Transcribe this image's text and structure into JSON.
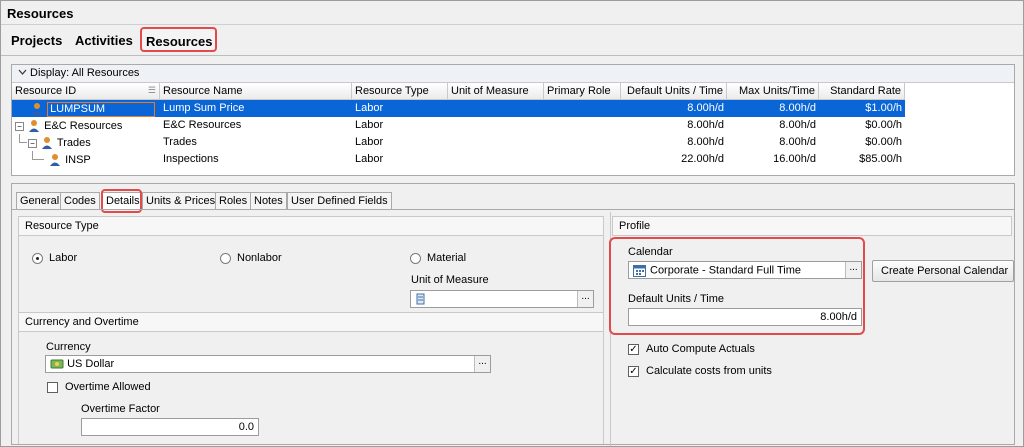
{
  "window": {
    "title": "Resources"
  },
  "nav": {
    "tabs": [
      {
        "label": "Projects"
      },
      {
        "label": "Activities"
      },
      {
        "label": "Resources"
      }
    ]
  },
  "grid": {
    "display_label": "Display: All Resources",
    "columns": [
      "Resource ID",
      "Resource Name",
      "Resource Type",
      "Unit of Measure",
      "Primary Role",
      "Default Units / Time",
      "Max Units/Time",
      "Standard Rate"
    ],
    "rows": [
      {
        "id": "LUMPSUM",
        "name": "Lump Sum Price",
        "type": "Labor",
        "unit": "",
        "role": "",
        "default_units": "8.00h/d",
        "max_units": "8.00h/d",
        "rate": "$1.00/h"
      },
      {
        "id": "E&C Resources",
        "name": "E&C Resources",
        "type": "Labor",
        "unit": "",
        "role": "",
        "default_units": "8.00h/d",
        "max_units": "8.00h/d",
        "rate": "$0.00/h"
      },
      {
        "id": "Trades",
        "name": "Trades",
        "type": "Labor",
        "unit": "",
        "role": "",
        "default_units": "8.00h/d",
        "max_units": "8.00h/d",
        "rate": "$0.00/h"
      },
      {
        "id": "INSP",
        "name": "Inspections",
        "type": "Labor",
        "unit": "",
        "role": "",
        "default_units": "22.00h/d",
        "max_units": "16.00h/d",
        "rate": "$85.00/h"
      }
    ]
  },
  "details": {
    "tabs": [
      "General",
      "Codes",
      "Details",
      "Units & Prices",
      "Roles",
      "Notes",
      "User Defined Fields"
    ],
    "active_tab": "Details",
    "resource_type": {
      "heading": "Resource Type",
      "options": [
        "Labor",
        "Nonlabor",
        "Material"
      ],
      "selected": "Labor",
      "unit_of_measure_label": "Unit of Measure",
      "unit_of_measure_value": ""
    },
    "currency_overtime": {
      "heading": "Currency and Overtime",
      "currency_label": "Currency",
      "currency_value": "US Dollar",
      "overtime_allowed_label": "Overtime Allowed",
      "overtime_allowed": false,
      "overtime_factor_label": "Overtime Factor",
      "overtime_factor_value": "0.0"
    },
    "profile": {
      "heading": "Profile",
      "calendar_label": "Calendar",
      "calendar_value": "Corporate - Standard Full Time",
      "create_calendar_button": "Create Personal Calendar",
      "default_units_label": "Default Units / Time",
      "default_units_value": "8.00h/d",
      "auto_compute_label": "Auto Compute Actuals",
      "auto_compute": true,
      "calc_costs_label": "Calculate costs from units",
      "calc_costs": true
    }
  },
  "colors": {
    "selection": "#0a66d6",
    "highlight_outline": "#e24b4b",
    "edit_outline": "#e87a2a",
    "person_icon": "#e0902a"
  },
  "ellipsis": "..."
}
